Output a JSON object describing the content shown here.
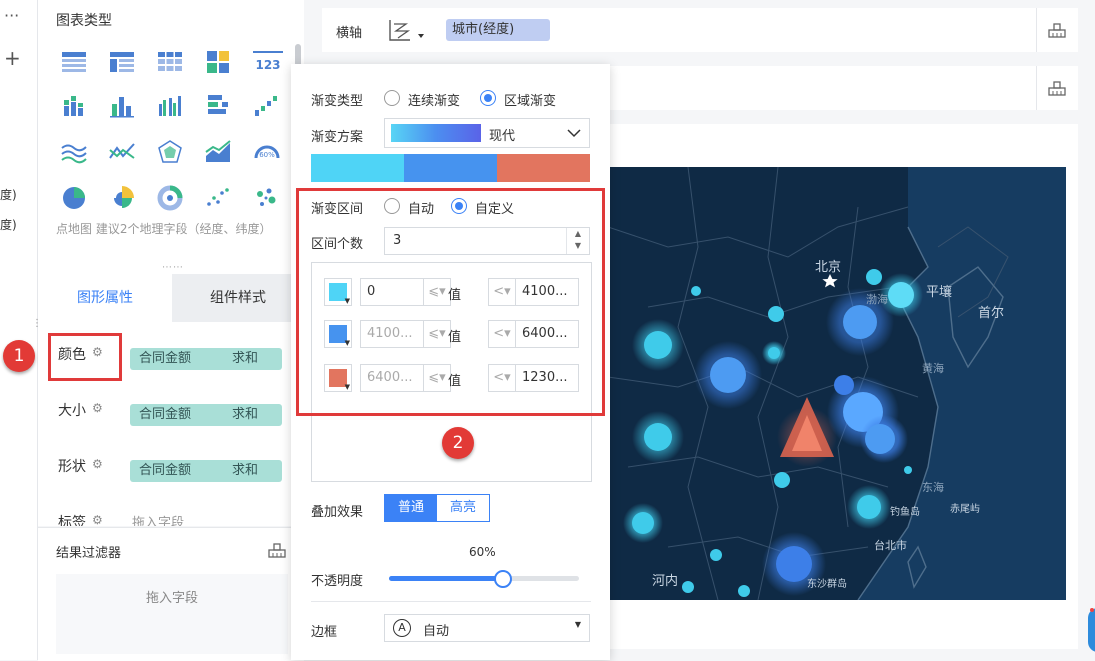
{
  "left_strip": {
    "more_glyph": "···",
    "add_glyph": "+",
    "frag1": "度)",
    "frag2": "度)"
  },
  "chart_type_panel": {
    "title": "图表类型",
    "hint": "点地图 建议2个地理字段（经度、纬度）",
    "number_card_label": "123",
    "gauge_label": "60%"
  },
  "props": {
    "tab_graph": "图形属性",
    "tab_style": "组件样式",
    "rows": [
      {
        "label": "颜色",
        "field": "合同金额",
        "agg": "求和"
      },
      {
        "label": "大小",
        "field": "合同金额",
        "agg": "求和"
      },
      {
        "label": "形状",
        "field": "合同金额",
        "agg": "求和"
      },
      {
        "label": "标签",
        "field": "拖入字段"
      }
    ]
  },
  "filter": {
    "title": "结果过滤器",
    "drop_hint": "拖入字段"
  },
  "axis": {
    "x_label": "横轴",
    "x_field": "城市(经度)"
  },
  "popup": {
    "gradient_type_label": "渐变类型",
    "gradient_type_options": [
      "连续渐变",
      "区域渐变"
    ],
    "gradient_type_selected": "区域渐变",
    "scheme_label": "渐变方案",
    "scheme_name": "现代",
    "gradient_colors": [
      "#4fd4f6",
      "#4693ef",
      "#e2755f"
    ],
    "range_label": "渐变区间",
    "range_options": [
      "自动",
      "自定义"
    ],
    "range_selected": "自定义",
    "count_label": "区间个数",
    "count_value": "3",
    "value_word": "值",
    "ranges": [
      {
        "color": "#4fd4f6",
        "from": "0",
        "to": "4100..."
      },
      {
        "color": "#4693ef",
        "from": "4100...",
        "to": "6400..."
      },
      {
        "color": "#e2755f",
        "from": "6400...",
        "to": "1230..."
      }
    ],
    "blend_label": "叠加效果",
    "blend_normal": "普通",
    "blend_highlight": "高亮",
    "opacity_label": "不透明度",
    "opacity_value": "60%",
    "opacity_fraction": 0.6,
    "border_label": "边框",
    "border_icon_letter": "A",
    "border_value": "自动"
  },
  "badges": {
    "one": "1",
    "two": "2"
  },
  "map": {
    "labels": [
      {
        "text": "北京",
        "kind": "city"
      },
      {
        "text": "渤海",
        "kind": "sea"
      },
      {
        "text": "平壤",
        "kind": "city"
      },
      {
        "text": "首尔",
        "kind": "city"
      },
      {
        "text": "黄海",
        "kind": "sea"
      },
      {
        "text": "东海",
        "kind": "sea"
      },
      {
        "text": "钓鱼岛",
        "kind": "island"
      },
      {
        "text": "赤尾屿",
        "kind": "island"
      },
      {
        "text": "台北市",
        "kind": "city"
      },
      {
        "text": "河内",
        "kind": "city"
      },
      {
        "text": "东沙群岛",
        "kind": "island"
      }
    ]
  }
}
